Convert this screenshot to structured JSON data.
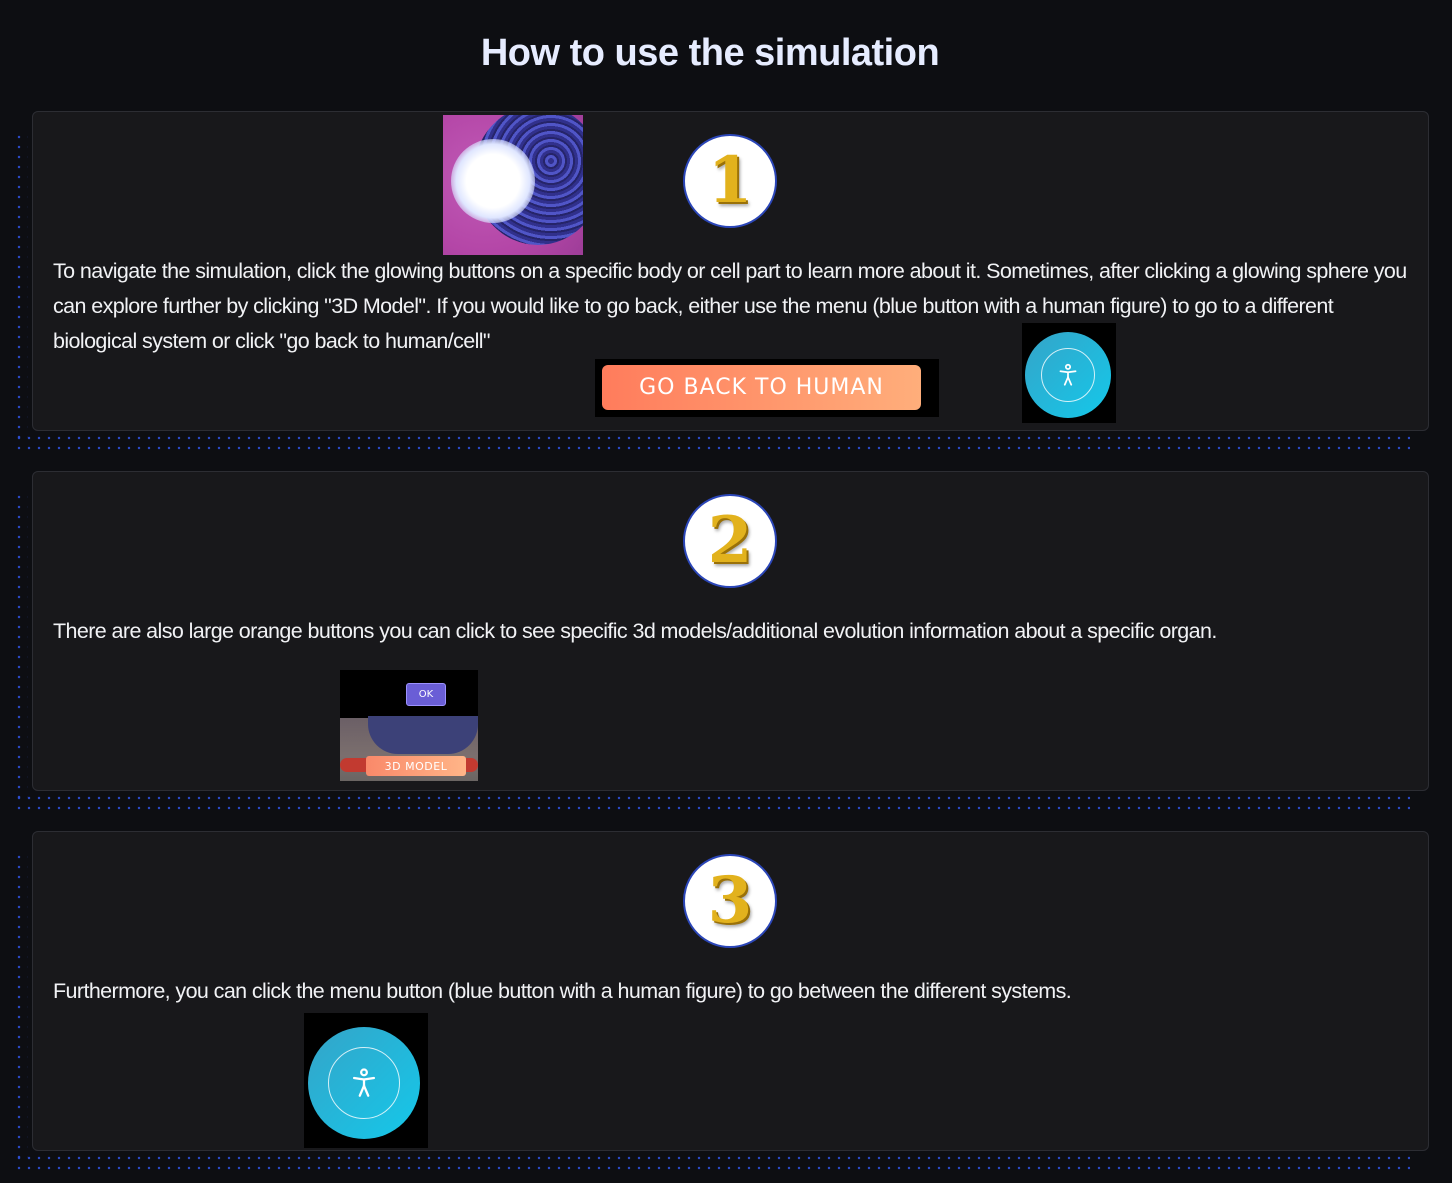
{
  "page": {
    "title": "How to use the simulation"
  },
  "steps": [
    {
      "number": "1",
      "text": "To navigate the simulation, click the glowing buttons on a specific body or cell part to learn more about it. Sometimes, after clicking a glowing sphere you can explore further by clicking \"3D Model\". If you would like to go back, either use the menu (blue button with a human figure) to go to a different biological system or click \"go back to human/cell\"",
      "back_button_label": "GO BACK TO HUMAN"
    },
    {
      "number": "2",
      "text": "There are also large orange buttons you can click to see specific 3d models/additional evolution information about a specific organ.",
      "ok_label": "OK",
      "model_button_label": "3D MODEL"
    },
    {
      "number": "3",
      "text": "Furthermore, you can click the menu button (blue button with a human figure) to go between the different systems."
    }
  ],
  "icons": {
    "menu": "human-figure-icon"
  },
  "colors": {
    "background": "#0d0e12",
    "card": "#18181b",
    "accent_orange": "#ff7c5c",
    "accent_blue": "#14c8ea",
    "dots": "#2d4fd6",
    "number_gold": "#e2b21d"
  }
}
